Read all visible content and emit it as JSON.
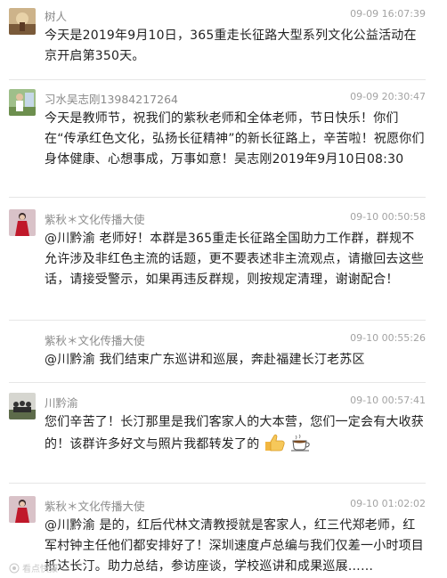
{
  "messages": [
    {
      "name": "树人",
      "time": "09-09 16:07:39",
      "text": "今天是2019年9月10日，365重走长征路大型系列文化公益活动在京开启第350天。",
      "avatar_icon": "landscape-avatar"
    },
    {
      "name": "习水吴志刚13984217264",
      "time": "09-09 20:30:47",
      "text": "今天是教师节，祝我们的紫秋老师和全体老师，节日快乐！你们在“传承红色文化，弘扬长征精神”的新长征路上，辛苦啦！祝愿你们身体健康、心想事成，万事如意！吴志刚2019年9月10日08:30",
      "avatar_icon": "person-outdoor-avatar"
    },
    {
      "name": "紫秋＊文化传播大使",
      "time": "09-10 00:50:58",
      "text": "@川黔渝 老师好！本群是365重走长征路全国助力工作群，群规不允许涉及非红色主流的话题，更不要表述非主流观点，请撤回去这些话，请接受警示，如果再违反群规，则按规定清理，谢谢配合！",
      "avatar_icon": "woman-red-dress-avatar"
    },
    {
      "name": "紫秋＊文化传播大使",
      "time": "09-10 00:55:26",
      "text": "@川黔渝 我们结束广东巡讲和巡展，奔赴福建长汀老苏区",
      "avatar_icon": ""
    },
    {
      "name": "川黔渝",
      "time": "09-10 00:57:41",
      "text": "您们辛苦了！长汀那里是我们客家人的大本营，您们一定会有大收获的！该群许多好文与照片我都转发了的",
      "avatar_icon": "group-photo-avatar",
      "emojis": [
        "thumbs-up-icon",
        "coffee-icon"
      ]
    },
    {
      "name": "紫秋＊文化传播大使",
      "time": "09-10 01:02:02",
      "text": "@川黔渝  是的，红后代林文清教授就是客家人，红三代郑老师，红军村钟主任他们都安排好了！深圳速度卢总编与我们仅差一小时项目抵达长汀。助力总结，参访座谈，学校巡讲和成果巡展……",
      "avatar_icon": "woman-red-dress-avatar"
    }
  ],
  "watermark": "看点快报",
  "colors": {
    "name": "#8a8a8a",
    "time": "#a3a3a3",
    "text": "#222222",
    "divider": "#e6e6e6"
  }
}
